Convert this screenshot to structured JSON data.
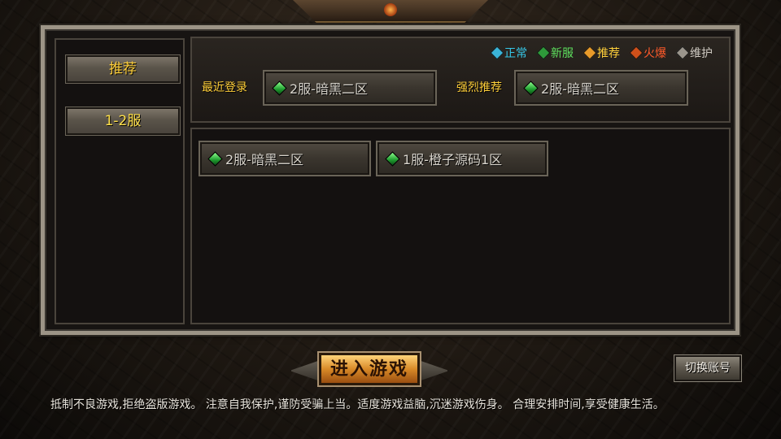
{
  "legend": [
    {
      "label": "正常",
      "color": "#36c8e8",
      "gem": "#3ab4d8"
    },
    {
      "label": "新服",
      "color": "#5ee05e",
      "gem": "#2e9a3a"
    },
    {
      "label": "推荐",
      "color": "#ffcf3a",
      "gem": "#e89a2a"
    },
    {
      "label": "火爆",
      "color": "#ff5a2a",
      "gem": "#d0501a"
    },
    {
      "label": "维护",
      "color": "#cfcac2",
      "gem": "#9a958c"
    }
  ],
  "tabs": {
    "recommend": "推荐",
    "range_1_2": "1-2服"
  },
  "labels": {
    "recent_login": "最近登录",
    "strong_recommend": "强烈推荐"
  },
  "recent_server": "2服-暗黑二区",
  "strong_server": "2服-暗黑二区",
  "server_list": [
    "2服-暗黑二区",
    "1服-橙子源码1区"
  ],
  "enter_button": "进入游戏",
  "switch_account": "切换账号",
  "notice": "抵制不良游戏,拒绝盗版游戏。 注意自我保护,谨防受骗上当。适度游戏益脑,沉迷游戏伤身。 合理安排时间,享受健康生活。"
}
